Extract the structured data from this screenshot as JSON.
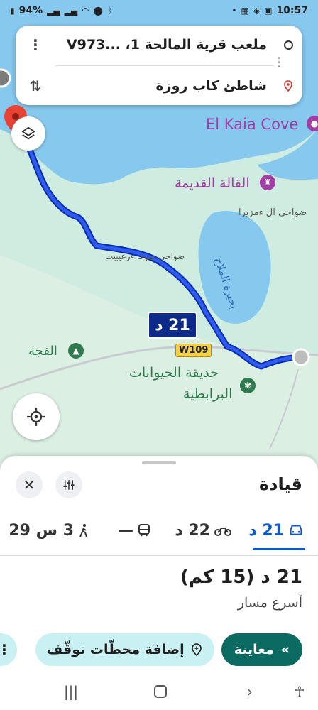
{
  "status_bar": {
    "battery": "94%",
    "time": "10:57"
  },
  "search": {
    "origin": "ملعب قرية المالحة 1، ...V973",
    "destination": "شاطئ كاب روزة"
  },
  "map": {
    "labels": {
      "cove": "El Kaia Cove",
      "citadel": "القالة القديمة",
      "mziraa": "ضواحي ال ءمزيرا",
      "village": "ضواحي صوك ءرعيبيت",
      "lake": "بحيرة الملاح",
      "fajja": "الفجة",
      "zoo_line1": "حديقة الحيوانات",
      "zoo_line2": "البرابطية"
    },
    "route_time_badge": "21 د",
    "road_shield": "W109",
    "colors": {
      "route": "#2446d8",
      "water": "#86c8ee",
      "land": "#cfece0",
      "poi_purple": "#a33ca5",
      "poi_green": "#2f7a4f"
    }
  },
  "sheet": {
    "title": "قيادة",
    "modes": [
      {
        "name": "drive",
        "icon": "car-icon",
        "time": "21 د"
      },
      {
        "name": "motorcycle",
        "icon": "motorcycle-icon",
        "time": "22 د"
      },
      {
        "name": "transit",
        "icon": "train-icon",
        "time": "—"
      },
      {
        "name": "walk",
        "icon": "walk-icon",
        "time": "3 س 29"
      }
    ],
    "eta": "21 د (15 كم)",
    "route_desc": "أسرع مسار",
    "preview_label": "معاينة",
    "add_stops_label": "إضافة محطّات توقّف"
  }
}
